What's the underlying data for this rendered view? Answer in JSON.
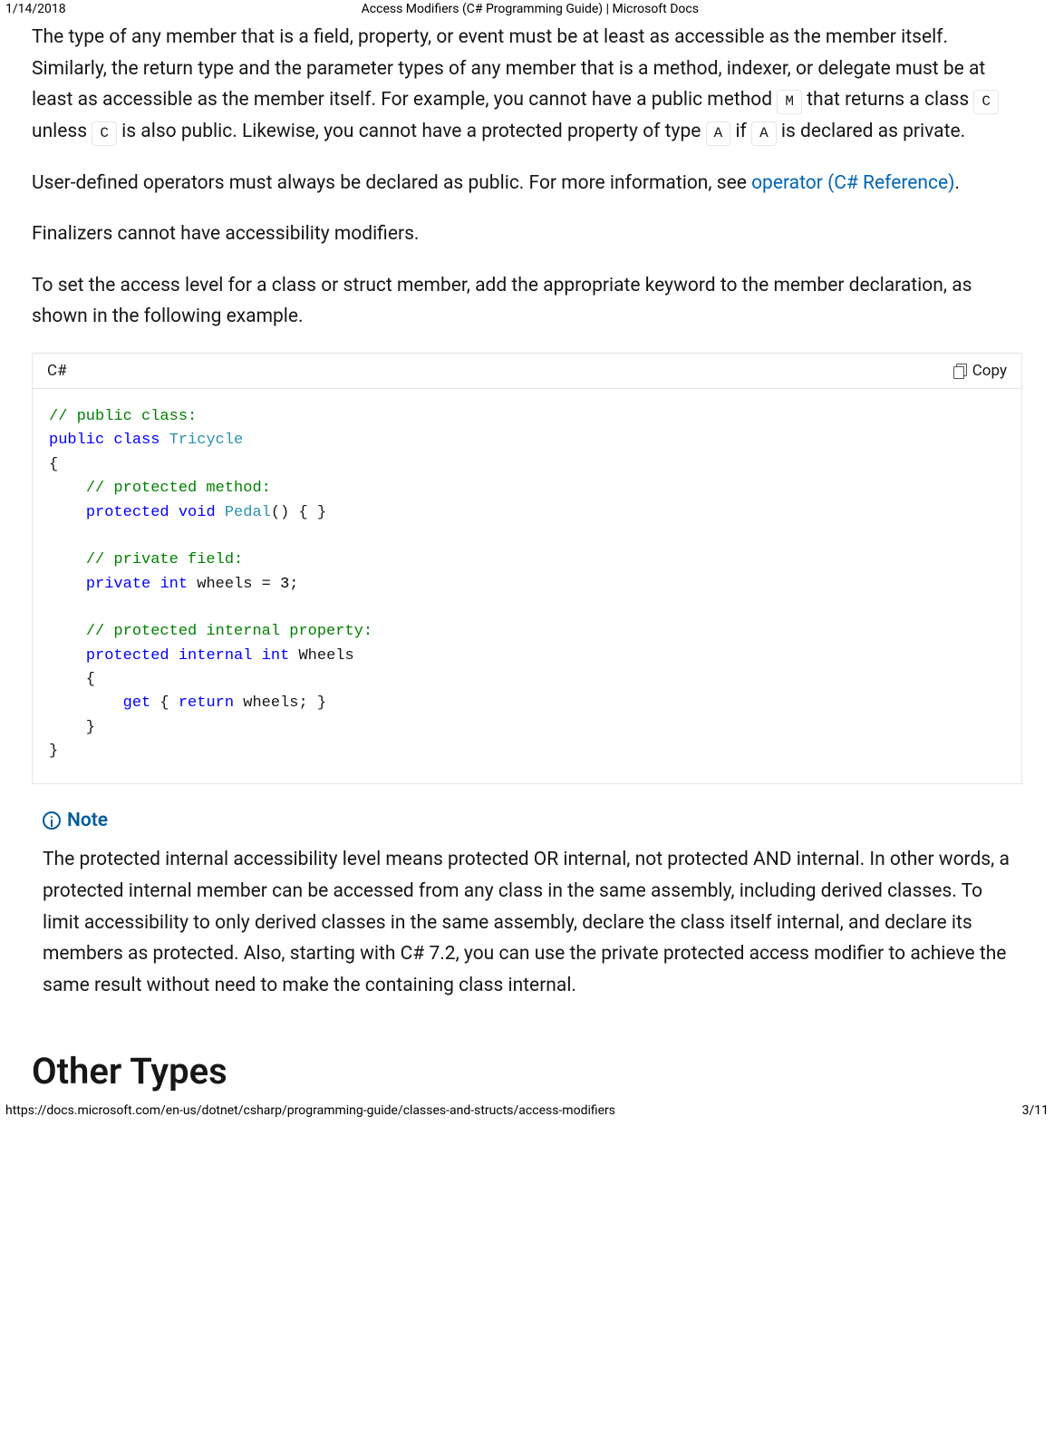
{
  "print_header": {
    "date": "1/14/2018",
    "title": "Access Modifiers (C# Programming Guide) | Microsoft Docs"
  },
  "paragraphs": {
    "p1_part1": "The type of any member that is a field, property, or event must be at least as accessible as the member itself. Similarly, the return type and the parameter types of any member that is a method, indexer, or delegate must be at least as accessible as the member itself. For example, you cannot have a public method ",
    "p1_code1": "M",
    "p1_part2": " that returns a class ",
    "p1_code2": "C",
    "p1_part3": " unless ",
    "p1_code3": "C",
    "p1_part4": " is also public. Likewise, you cannot have a protected property of type ",
    "p1_code4": "A",
    "p1_part5": " if ",
    "p1_code5": "A",
    "p1_part6": " is declared as private.",
    "p2_part1": "User-defined operators must always be declared as public. For more information, see ",
    "p2_link": "operator (C# Reference)",
    "p2_part2": ".",
    "p3": "Finalizers cannot have accessibility modifiers.",
    "p4": "To set the access level for a class or struct member, add the appropriate keyword to the member declaration, as shown in the following example."
  },
  "code_block": {
    "lang": "C#",
    "copy_label": "Copy",
    "tokens": {
      "c1": "// public class:",
      "k_public": "public",
      "k_class": "class",
      "t_tricycle": "Tricycle",
      "c2": "// protected method:",
      "k_protected": "protected",
      "k_void": "void",
      "t_pedal": "Pedal",
      "c3": "// private field:",
      "k_private": "private",
      "k_int": "int",
      "id_wheels": "wheels",
      "n3": "3",
      "c4": "// protected internal property:",
      "k_internal": "internal",
      "id_Wheels": "Wheels",
      "k_get": "get",
      "k_return": "return"
    }
  },
  "note": {
    "title": "Note",
    "text": "The protected internal accessibility level means protected OR internal, not protected AND internal. In other words, a protected internal member can be accessed from any class in the same assembly, including derived classes. To limit accessibility to only derived classes in the same assembly, declare the class itself internal, and declare its members as protected. Also, starting with C# 7.2, you can use the private protected access modifier to achieve the same result without need to make the containing class internal."
  },
  "heading": "Other Types",
  "print_footer": {
    "url": "https://docs.microsoft.com/en-us/dotnet/csharp/programming-guide/classes-and-structs/access-modifiers",
    "page": "3/11"
  }
}
